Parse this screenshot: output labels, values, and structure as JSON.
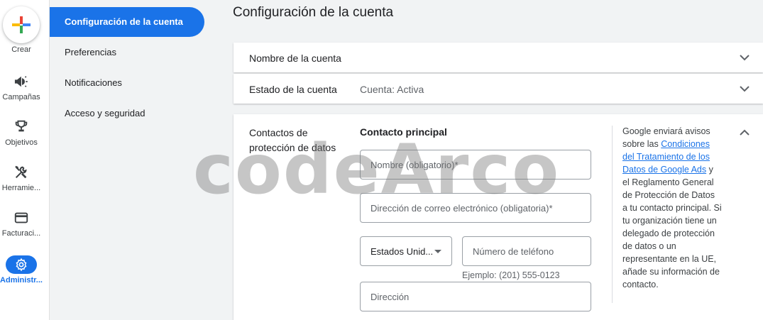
{
  "rail": {
    "create": "Crear",
    "items": [
      {
        "label": "Campañas",
        "icon": "megaphone-icon"
      },
      {
        "label": "Objetivos",
        "icon": "trophy-icon"
      },
      {
        "label": "Herramientas",
        "icon": "tools-icon"
      },
      {
        "label": "Facturación",
        "icon": "credit-card-icon"
      },
      {
        "label": "Administración",
        "icon": "gear-icon"
      }
    ],
    "display": [
      "Campañas",
      "Objetivos",
      "Herramie...",
      "Facturaci...",
      "Administr..."
    ]
  },
  "subnav": {
    "items": [
      "Configuración de la cuenta",
      "Preferencias",
      "Notificaciones",
      "Acceso y seguridad"
    ],
    "active_index": 0
  },
  "page": {
    "title": "Configuración de la cuenta"
  },
  "panels": {
    "account_name": {
      "title": "Nombre de la cuenta"
    },
    "account_status": {
      "title": "Estado de la cuenta",
      "value": "Cuenta: Activa"
    },
    "data_protection": {
      "title": "Contactos de protección de datos",
      "contact_title": "Contacto principal",
      "name_placeholder": "Nombre (obligatorio)*",
      "email_placeholder": "Dirección de correo electrónico (obligatoria)*",
      "country_value": "Estados Unid...",
      "phone_placeholder": "Número de teléfono",
      "phone_hint": "Ejemplo: (201) 555-0123",
      "address_placeholder": "Dirección",
      "info_pre": "Google enviará avisos sobre las ",
      "info_link": "Condiciones del Tratamiento de los Datos de Google Ads",
      "info_post": " y el Reglamento General de Protección de Datos a tu contacto principal. Si tu organización tiene un delegado de protección de datos o un representante en la UE, añade su información de contacto."
    }
  },
  "watermark": "codeArco",
  "colors": {
    "accent": "#1a73e8",
    "background": "#f1f3f4"
  }
}
